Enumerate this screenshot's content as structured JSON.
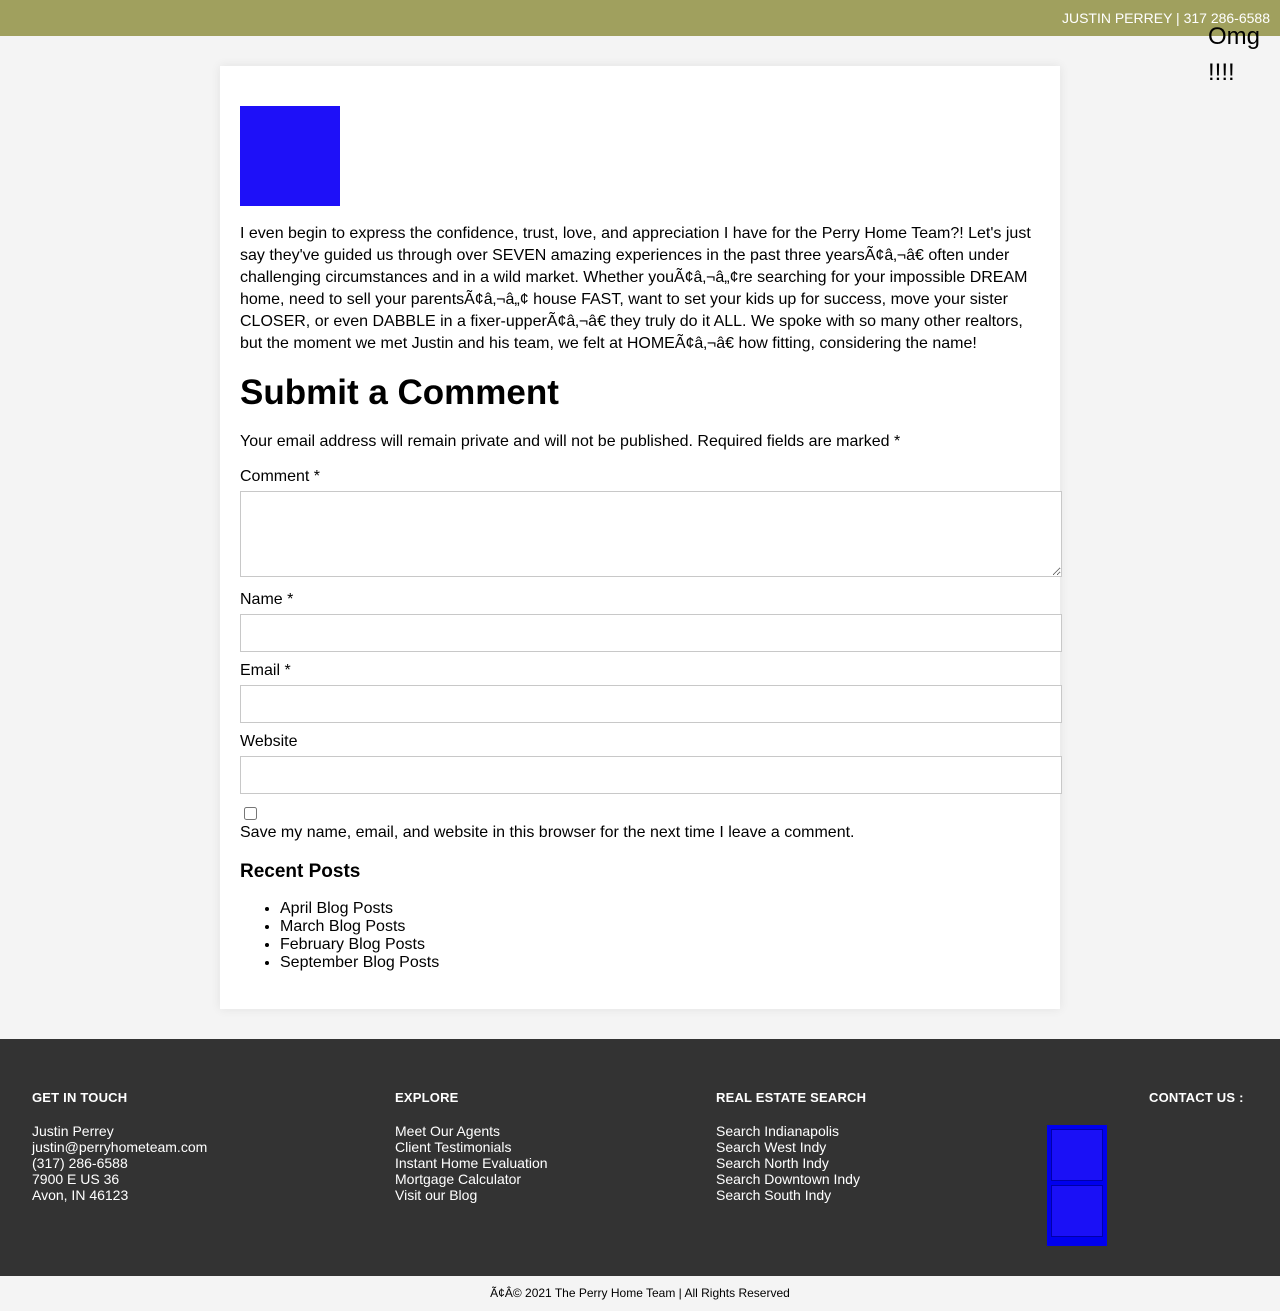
{
  "topbar": {
    "contact_text": "JUSTIN PERREY | 317 286-6588"
  },
  "overlay": {
    "omg_text": "Omg !!!!"
  },
  "post": {
    "body": "I even begin to express the confidence, trust, love, and appreciation I have for the Perry Home Team?! Let's just say they've guided us through over SEVEN amazing experiences in the past three yearsÃ¢â‚¬â€ often under challenging circumstances and in a wild market. Whether youÃ¢â‚¬â„¢re searching for your impossible DREAM home, need to sell your parentsÃ¢â‚¬â„¢ house FAST, want to set your kids up for success, move your sister CLOSER, or even DABBLE in a fixer-upperÃ¢â‚¬â€ they truly do it ALL. We spoke with so many other realtors, but the moment we met Justin and his team, we felt at HOMEÃ¢â‚¬â€ how fitting, considering the name!"
  },
  "comment_form": {
    "title": "Submit a Comment",
    "privacy_note": "Your email address will remain private and will not be published. Required fields are marked *",
    "comment_label": "Comment *",
    "comment_value": "",
    "name_label": "Name *",
    "name_value": "",
    "email_label": "Email *",
    "email_value": "",
    "website_label": "Website",
    "website_value": "",
    "save_checked": false,
    "save_label": "Save my name, email, and website in this browser for the next time I leave a comment."
  },
  "recent_posts": {
    "heading": "Recent Posts",
    "items": [
      "April Blog Posts",
      "March Blog Posts",
      "February Blog Posts",
      "September Blog Posts"
    ]
  },
  "footer": {
    "get_in_touch": {
      "heading": "GET IN TOUCH",
      "lines": [
        "Justin Perrey",
        "justin@perryhometeam.com",
        "(317) 286-6588",
        "7900 E US 36",
        "Avon, IN 46123"
      ]
    },
    "explore": {
      "heading": "EXPLORE",
      "links": [
        "Meet Our Agents",
        "Client Testimonials",
        "Instant Home Evaluation",
        "Mortgage Calculator",
        "Visit our Blog"
      ]
    },
    "real_estate_search": {
      "heading": "REAL ESTATE SEARCH",
      "links": [
        "Search Indianapolis",
        "Search West Indy",
        "Search North Indy",
        "Search Downtown Indy",
        "Search South Indy"
      ]
    },
    "contact_us": {
      "heading": "CONTACT US :"
    }
  },
  "copyright": "Ã¢Â© 2021 The Perry Home Team | All Rights Reserved",
  "colors": {
    "topbar": "#a0a05e",
    "footer": "#333333",
    "image_placeholder": "#1e10f8",
    "social_box": "#0000ee"
  }
}
